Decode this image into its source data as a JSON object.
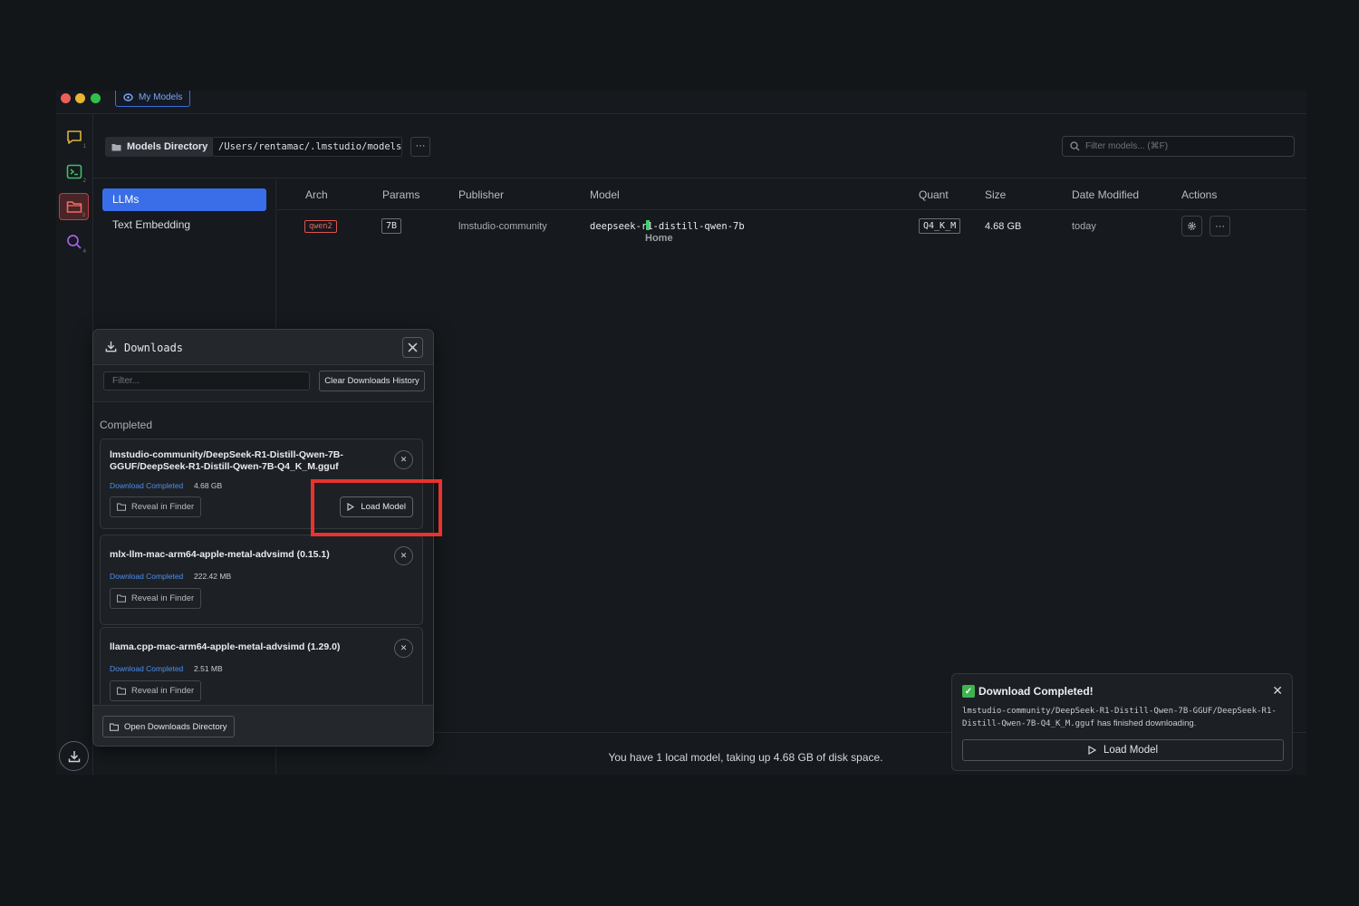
{
  "titlebar": {
    "tab_label": "My Models"
  },
  "rail": {
    "items": [
      {
        "num": "1"
      },
      {
        "num": "2"
      },
      {
        "num": "3"
      },
      {
        "num": "4"
      }
    ]
  },
  "topbar": {
    "models_directory_label": "Models Directory",
    "models_directory_path": "/Users/rentamac/.lmstudio/models",
    "more_label": "···",
    "filter_placeholder": "Filter models... (⌘F)"
  },
  "categories": [
    {
      "label": "LLMs",
      "active": true
    },
    {
      "label": "Text Embedding",
      "active": false
    }
  ],
  "table": {
    "headers": [
      "Arch",
      "Params",
      "Publisher",
      "Model",
      "Quant",
      "Size",
      "Date Modified",
      "Actions"
    ],
    "rows": [
      {
        "arch": "qwen2",
        "params": "7B",
        "publisher": "lmstudio-community",
        "model": "deepseek-r1-distill-qwen-7b",
        "quant": "Q4_K_M",
        "size": "4.68 GB",
        "date_modified": "today"
      }
    ],
    "tooltip": "Home"
  },
  "footer": {
    "text": "You have 1 local model, taking up 4.68 GB of disk space."
  },
  "downloads": {
    "title": "Downloads",
    "filter_placeholder": "Filter...",
    "clear_label": "Clear Downloads History",
    "section_label": "Completed",
    "items": [
      {
        "name": "lmstudio-community/DeepSeek-R1-Distill-Qwen-7B-GGUF/DeepSeek-R1-Distill-Qwen-7B-Q4_K_M.gguf",
        "status": "Download Completed",
        "size": "4.68 GB",
        "reveal_label": "Reveal in Finder",
        "load_label": "Load Model"
      },
      {
        "name": "mlx-llm-mac-arm64-apple-metal-advsimd (0.15.1)",
        "status": "Download Completed",
        "size": "222.42 MB",
        "reveal_label": "Reveal in Finder"
      },
      {
        "name": "llama.cpp-mac-arm64-apple-metal-advsimd (1.29.0)",
        "status": "Download Completed",
        "size": "2.51 MB",
        "reveal_label": "Reveal in Finder"
      }
    ],
    "open_dir_label": "Open Downloads Directory"
  },
  "toast": {
    "title": "Download Completed!",
    "path": "lmstudio-community/DeepSeek-R1-Distill-Qwen-7B-GGUF/DeepSeek-R1-Distill-Qwen-7B-Q4_K_M.gguf",
    "suffix": " has finished downloading.",
    "load_label": "Load Model"
  },
  "colors": {
    "accent": "#3a6ee8",
    "highlight": "#e8332e",
    "status_link": "#4e8ef0",
    "success": "#3fb34f",
    "arch_badge": "#e0534d"
  }
}
